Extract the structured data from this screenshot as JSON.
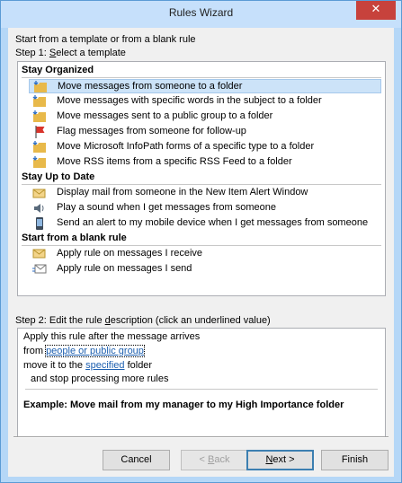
{
  "window": {
    "title": "Rules Wizard",
    "close_glyph": "✕"
  },
  "intro": {
    "line1": "Start from a template or from a blank rule"
  },
  "step1": {
    "label_pre": "Step 1: ",
    "label_mnemonic": "S",
    "label_post": "elect a template"
  },
  "groups": {
    "organized": "Stay Organized",
    "uptodate": "Stay Up to Date",
    "blank": "Start from a blank rule"
  },
  "templates": [
    {
      "label": "Move messages from someone to a folder",
      "icon": "folder-arrow-icon"
    },
    {
      "label": "Move messages with specific words in the subject to a folder",
      "icon": "folder-arrow-icon"
    },
    {
      "label": "Move messages sent to a public group to a folder",
      "icon": "folder-arrow-icon"
    },
    {
      "label": "Flag messages from someone for follow-up",
      "icon": "flag-icon"
    },
    {
      "label": "Move Microsoft InfoPath forms of a specific type to a folder",
      "icon": "folder-arrow-icon"
    },
    {
      "label": "Move RSS items from a specific RSS Feed to a folder",
      "icon": "folder-arrow-icon"
    },
    {
      "label": "Display mail from someone in the New Item Alert Window",
      "icon": "envelope-alert-icon"
    },
    {
      "label": "Play a sound when I get messages from someone",
      "icon": "speaker-icon"
    },
    {
      "label": "Send an alert to my mobile device when I get messages from someone",
      "icon": "mobile-device-icon"
    },
    {
      "label": "Apply rule on messages I receive",
      "icon": "envelope-icon"
    },
    {
      "label": "Apply rule on messages I send",
      "icon": "outgoing-envelope-icon"
    }
  ],
  "step2": {
    "label_pre": "Step 2: Edit the rule ",
    "label_mnemonic": "d",
    "label_post": "escription (click an underlined value)"
  },
  "description": {
    "line1": "Apply this rule after the message arrives",
    "line2_pre": "from ",
    "line2_link": "people or public group",
    "line3_pre": "move it to the ",
    "line3_link": "specified",
    "line3_post": " folder",
    "line4": "and stop processing more rules",
    "example": "Example: Move mail from my manager to my High Importance folder"
  },
  "buttons": {
    "cancel": "Cancel",
    "back_pre": "< ",
    "back_mnemonic": "B",
    "back_post": "ack",
    "next_mnemonic": "N",
    "next_post": "ext >",
    "finish": "Finish"
  },
  "colors": {
    "selection": "#cce3f8",
    "link": "#1c5fb0",
    "folder": "#e8b94a",
    "flag": "#d9342b",
    "close": "#c7423c"
  }
}
